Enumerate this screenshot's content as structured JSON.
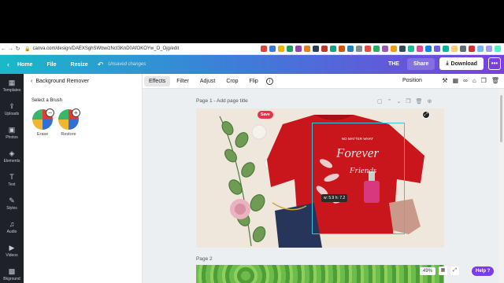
{
  "browser": {
    "url": "canva.com/design/DAEXSghSWbw/zNct3KnD0AfOKOYw_O_Ojg/edit",
    "extension_colors": [
      "#e0453a",
      "#3a7bd5",
      "#f0b400",
      "#1ba261",
      "#8e44ad",
      "#e67e22",
      "#2c3e50",
      "#c0392b",
      "#16a085",
      "#d35400",
      "#2980b9",
      "#7f8c8d",
      "#e74c3c",
      "#27ae60",
      "#9b59b6",
      "#f39c12",
      "#34495e",
      "#1abc9c",
      "#e84393",
      "#0984e3",
      "#6c5ce7",
      "#00b894",
      "#fdcb6e",
      "#636e72",
      "#d63031",
      "#74b9ff",
      "#a29bfe",
      "#55efc4"
    ]
  },
  "header": {
    "home_label": "Home",
    "file_label": "File",
    "resize_label": "Resize",
    "unsaved_label": "Unsaved changes",
    "title_label": "THE",
    "share_label": "Share",
    "download_label": "Download",
    "more_label": "•••"
  },
  "rail": {
    "items": [
      {
        "label": "Templates",
        "icon": "templates-icon",
        "glyph": "▦"
      },
      {
        "label": "Uploads",
        "icon": "upload-icon",
        "glyph": "⇪"
      },
      {
        "label": "Photos",
        "icon": "photos-icon",
        "glyph": "▣"
      },
      {
        "label": "Elements",
        "icon": "elements-icon",
        "glyph": "◈"
      },
      {
        "label": "Text",
        "icon": "text-icon",
        "glyph": "T"
      },
      {
        "label": "Styles",
        "icon": "styles-icon",
        "glyph": "✎"
      },
      {
        "label": "Audio",
        "icon": "audio-icon",
        "glyph": "♫"
      },
      {
        "label": "Videos",
        "icon": "videos-icon",
        "glyph": "▶"
      },
      {
        "label": "Bkground",
        "icon": "background-icon",
        "glyph": "▩"
      }
    ]
  },
  "panel": {
    "title": "Background Remover",
    "subtitle": "Select a Brush",
    "brushes": [
      {
        "label": "Erase",
        "badge": "−"
      },
      {
        "label": "Restore",
        "badge": "+"
      }
    ]
  },
  "toolbar": {
    "effects_label": "Effects",
    "filter_label": "Filter",
    "adjust_label": "Adjust",
    "crop_label": "Crop",
    "flip_label": "Flip",
    "info_label": "i",
    "position_label": "Position"
  },
  "canvas": {
    "page1_label": "Page 1 - Add page title",
    "page2_label": "Page 2",
    "save_badge": "Save",
    "dimension_tip": "w: 5.9 h: 7.2",
    "shirt_text_top": "NO MATTER WHAT",
    "shirt_text_main": "Forever",
    "shirt_text_sub": "Friends",
    "zoom_value": "49%",
    "help_label": "Help ?"
  }
}
